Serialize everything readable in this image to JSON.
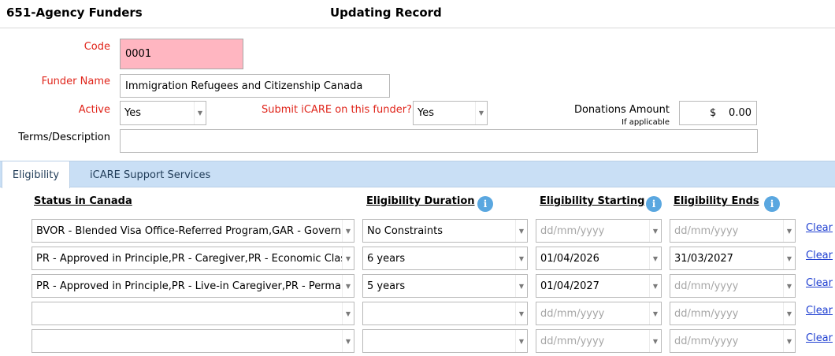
{
  "header": {
    "app_title": "651-Agency Funders",
    "record_status": "Updating Record"
  },
  "form": {
    "code_label": "Code",
    "code_value": "0001",
    "funder_name_label": "Funder Name",
    "funder_name_value": "Immigration Refugees and Citizenship Canada",
    "active_label": "Active",
    "active_value": "Yes",
    "submit_icare_label": "Submit iCARE on this funder?",
    "submit_icare_value": "Yes",
    "donations_label": "Donations Amount",
    "donations_note": "If applicable",
    "donations_currency": "$",
    "donations_value": "0.00",
    "terms_label": "Terms/Description",
    "terms_value": ""
  },
  "tabs": [
    {
      "label": "Eligibility",
      "active": true
    },
    {
      "label": "iCARE Support Services",
      "active": false
    }
  ],
  "eligibility": {
    "headers": {
      "status": "Status in Canada",
      "duration": "Eligibility Duration",
      "starting": "Eligibility Starting",
      "ends": "Eligibility Ends"
    },
    "info_icon": "i",
    "date_placeholder": "dd/mm/yyyy",
    "clear_label": "Clear",
    "rows": [
      {
        "status": "BVOR - Blended Visa Office-Referred Program,GAR - Govern",
        "duration": "No Constraints",
        "starting": "",
        "ends": ""
      },
      {
        "status": "PR - Approved in Principle,PR - Caregiver,PR - Economic Clas",
        "duration": "6 years",
        "starting": "01/04/2026",
        "ends": "31/03/2027"
      },
      {
        "status": "PR - Approved in Principle,PR - Live-in Caregiver,PR - Perma",
        "duration": "5 years",
        "starting": "01/04/2027",
        "ends": ""
      },
      {
        "status": "",
        "duration": "",
        "starting": "",
        "ends": ""
      },
      {
        "status": "",
        "duration": "",
        "starting": "",
        "ends": ""
      }
    ]
  },
  "colors": {
    "required_label": "#e0251b",
    "code_field_bg": "#ffb6c1",
    "tab_strip": "#c9dff5",
    "info_icon": "#5aa7e0",
    "link": "#1f3fd1"
  }
}
